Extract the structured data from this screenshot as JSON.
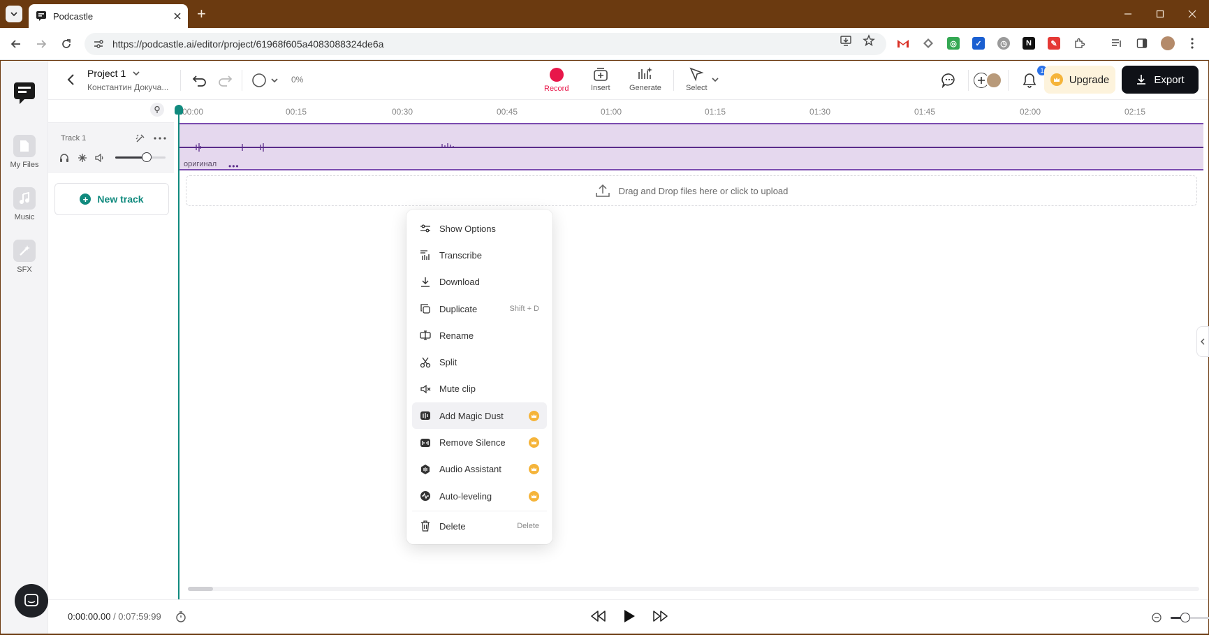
{
  "browser": {
    "tab_title": "Podcastle",
    "url": "https://podcastle.ai/editor/project/61968f605a4083088324de6a"
  },
  "sidebar": {
    "items": [
      {
        "label": "My Files",
        "icon": "file-icon"
      },
      {
        "label": "Music",
        "icon": "music-note-icon"
      },
      {
        "label": "SFX",
        "icon": "magic-wand-icon"
      }
    ]
  },
  "header": {
    "project_name": "Project 1",
    "project_owner": "Константин Докуча...",
    "progress_text": "0%",
    "tools": [
      {
        "label": "Record"
      },
      {
        "label": "Insert"
      },
      {
        "label": "Generate"
      },
      {
        "label": "Select"
      }
    ],
    "notification_count": "1",
    "upgrade_label": "Upgrade",
    "export_label": "Export"
  },
  "timeline": {
    "ticks": [
      "00:00",
      "00:15",
      "00:30",
      "00:45",
      "01:00",
      "01:15",
      "01:30",
      "01:45",
      "02:00",
      "02:15"
    ]
  },
  "track": {
    "name": "Track 1",
    "clip_label": "оригинал",
    "volume_level": 0.62
  },
  "new_track_label": "New track",
  "dropzone_text": "Drag and Drop files here or click to upload",
  "context_menu": {
    "items": [
      {
        "label": "Show Options",
        "icon": "sliders-icon"
      },
      {
        "label": "Transcribe",
        "icon": "transcribe-icon"
      },
      {
        "label": "Download",
        "icon": "download-icon"
      },
      {
        "label": "Duplicate",
        "icon": "duplicate-icon",
        "shortcut": "Shift + D"
      },
      {
        "label": "Rename",
        "icon": "rename-icon"
      },
      {
        "label": "Split",
        "icon": "scissors-icon"
      },
      {
        "label": "Mute clip",
        "icon": "mute-icon"
      },
      {
        "label": "Add Magic Dust",
        "icon": "magic-dust-icon",
        "pro": true
      },
      {
        "label": "Remove Silence",
        "icon": "remove-silence-icon",
        "pro": true
      },
      {
        "label": "Audio Assistant",
        "icon": "audio-assistant-icon",
        "pro": true
      },
      {
        "label": "Auto-leveling",
        "icon": "auto-leveling-icon",
        "pro": true
      },
      {
        "label": "Delete",
        "icon": "trash-icon",
        "shortcut": "Delete"
      }
    ]
  },
  "playback": {
    "current_time": "0:00:00.00",
    "total_time": "/ 0:07:59:99",
    "zoom_level": 0.35
  },
  "colors": {
    "accent": "#118a7e",
    "record": "#e8174a",
    "clip_fill": "#e5d8ee",
    "clip_border": "#7b4bb0",
    "pro_badge": "#f5b43a"
  }
}
